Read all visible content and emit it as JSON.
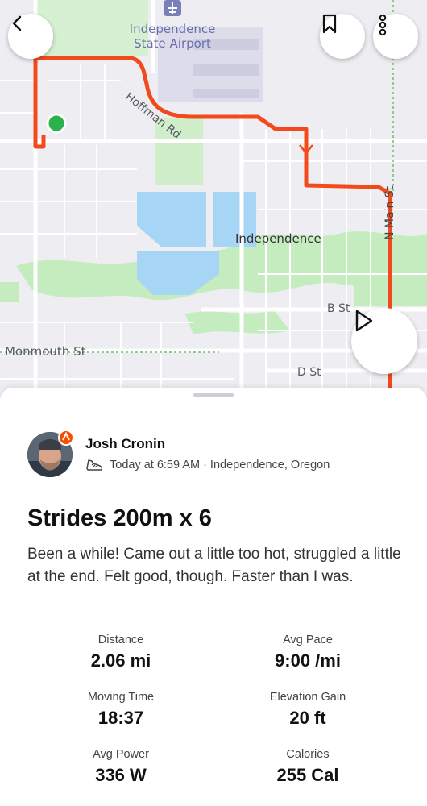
{
  "map": {
    "labels": {
      "airport_line1": "Independence",
      "airport_line2": "State Airport",
      "hoffman_rd": "Hoffman Rd",
      "independence": "Independence",
      "n_main_st": "N Main St",
      "b_st": "B St",
      "monmouth_st": "Monmouth St",
      "d_st": "D St"
    },
    "colors": {
      "route": "#f24a1d",
      "start_marker": "#2bb24c",
      "water": "#9fd3f5",
      "park": "#c9eec4"
    }
  },
  "controls": {
    "back_icon": "chevron-left-icon",
    "bookmark_icon": "bookmark-icon",
    "more_icon": "more-vertical-icon",
    "play_icon": "play-icon"
  },
  "activity": {
    "athlete_name": "Josh Cronin",
    "meta": "Today at 6:59 AM · Independence, Oregon",
    "activity_icon": "shoe-icon",
    "title": "Strides 200m x 6",
    "description": "Been a while! Came out a little too hot, struggled a little at the end. Felt good, though. Faster than I was."
  },
  "stats": [
    {
      "label": "Distance",
      "value": "2.06 mi"
    },
    {
      "label": "Avg Pace",
      "value": "9:00 /mi"
    },
    {
      "label": "Moving Time",
      "value": "18:37"
    },
    {
      "label": "Elevation Gain",
      "value": "20 ft"
    },
    {
      "label": "Avg Power",
      "value": "336 W"
    },
    {
      "label": "Calories",
      "value": "255 Cal"
    }
  ],
  "accent": "#fc4c02"
}
